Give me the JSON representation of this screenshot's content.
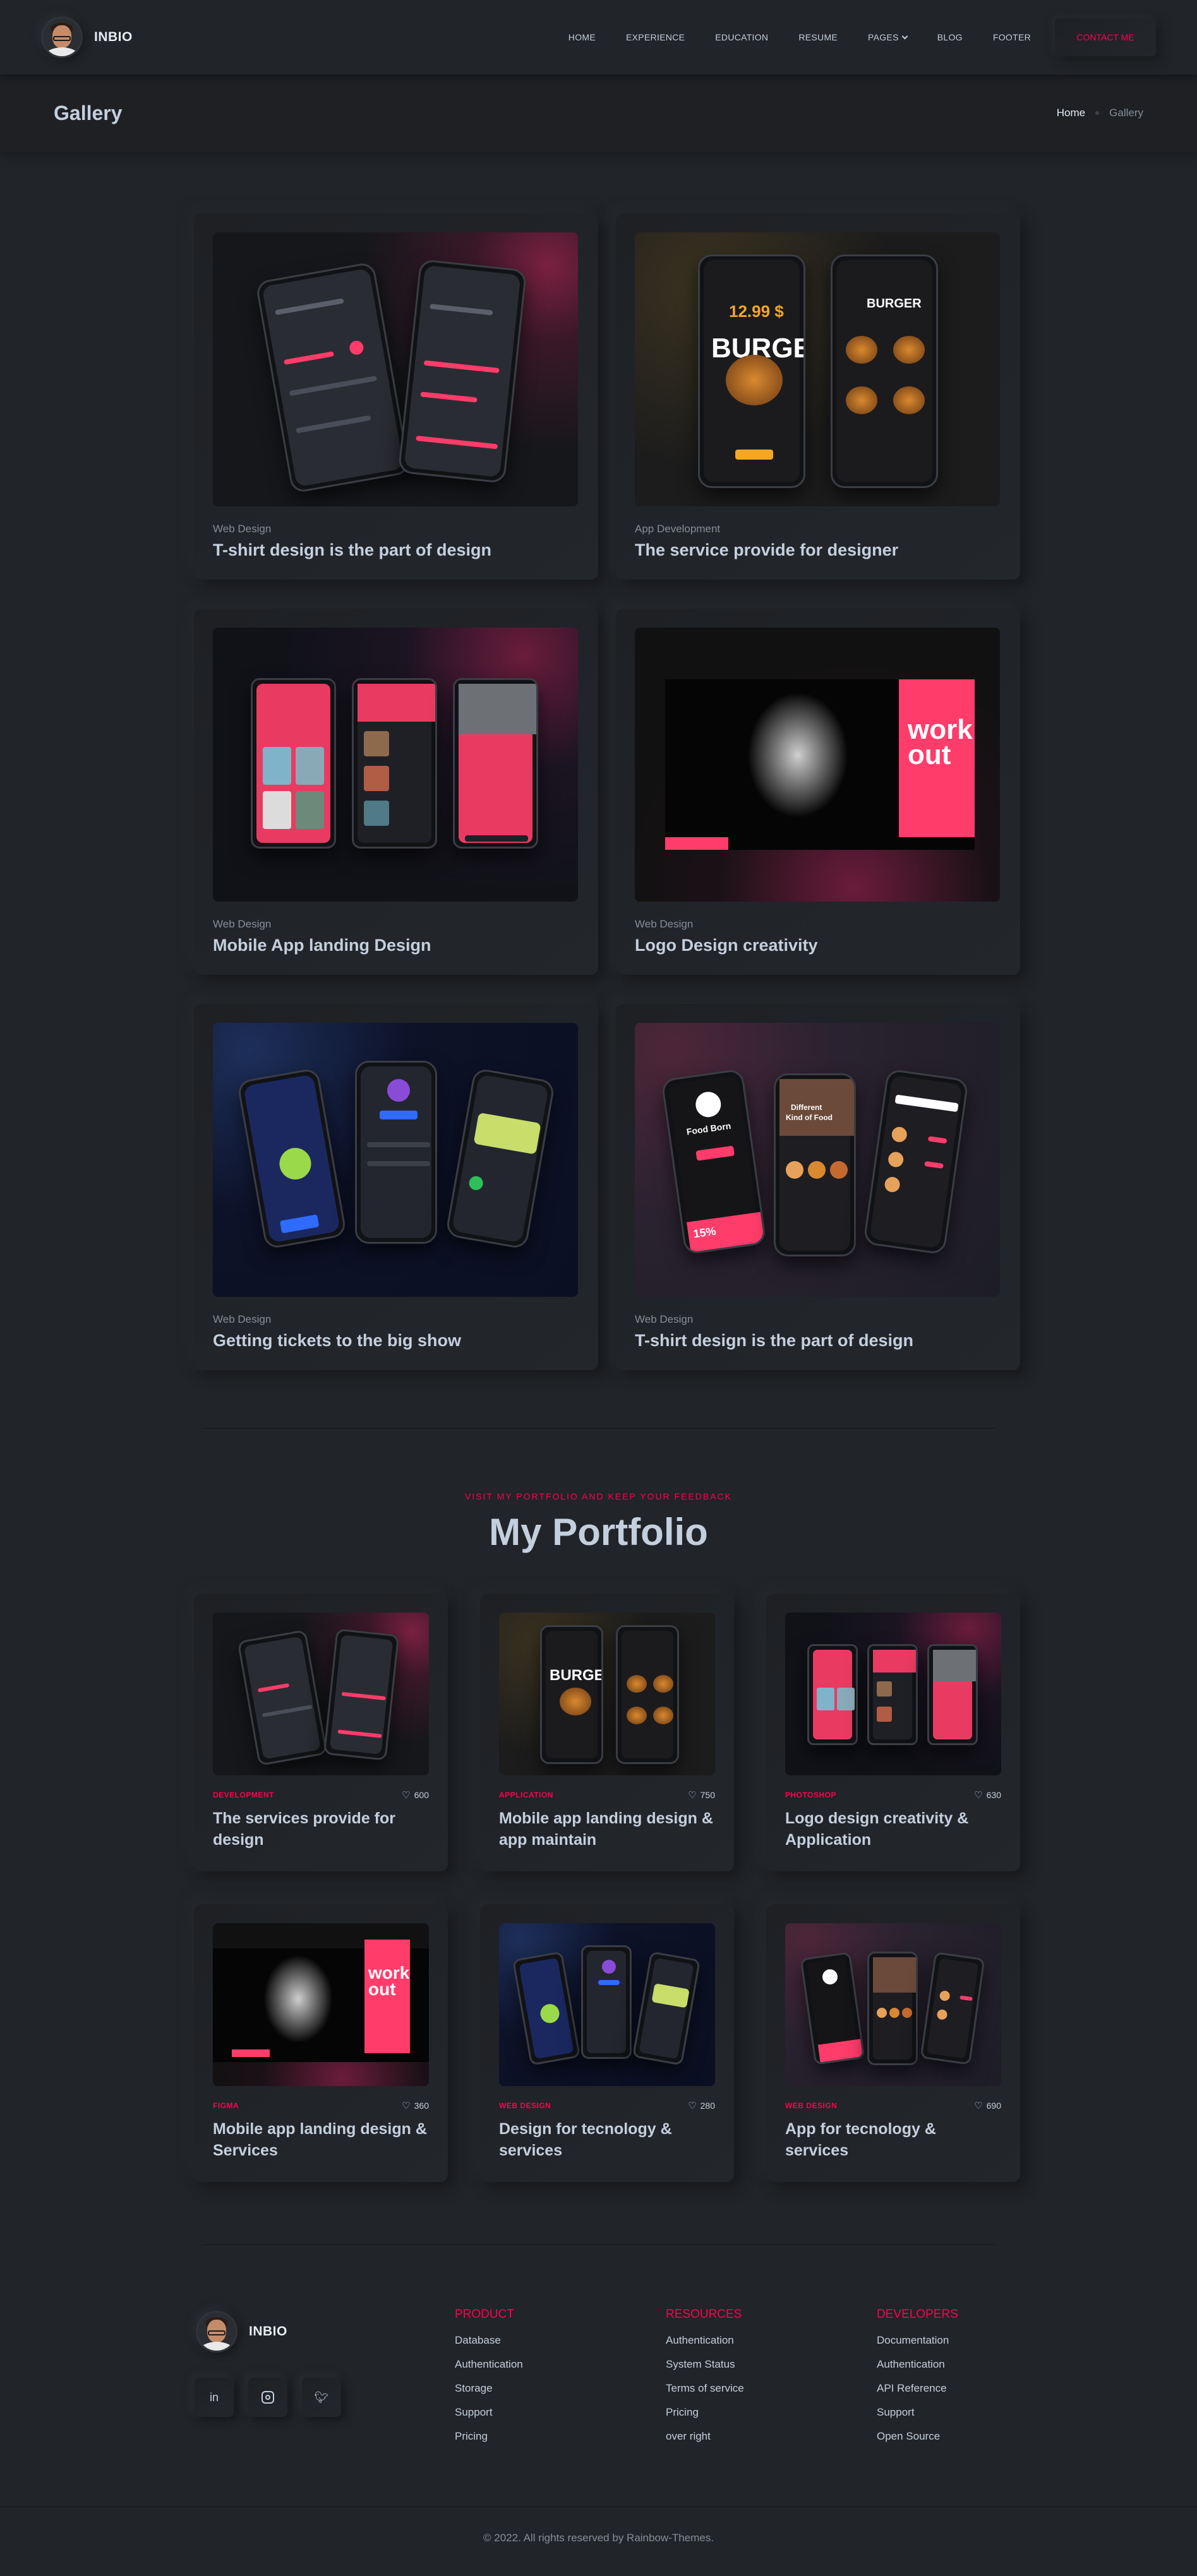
{
  "header": {
    "brand": "INBIO",
    "nav": [
      "HOME",
      "EXPERIENCE",
      "EDUCATION",
      "RESUME",
      "PAGES",
      "BLOG",
      "FOOTER"
    ],
    "contact_label": "CONTACT ME"
  },
  "breadcrumb": {
    "title": "Gallery",
    "home": "Home",
    "current": "Gallery"
  },
  "gallery": [
    {
      "category": "Web Design",
      "title": "T-shirt design is the part of design"
    },
    {
      "category": "App Development",
      "title": "The service provide for designer"
    },
    {
      "category": "Web Design",
      "title": "Mobile App landing Design"
    },
    {
      "category": "Web Design",
      "title": "Logo Design creativity"
    },
    {
      "category": "Web Design",
      "title": "Getting tickets to the big show"
    },
    {
      "category": "Web Design",
      "title": "T-shirt design is the part of design"
    }
  ],
  "thumb_text": {
    "price": "12.99 $",
    "burger": "BURGER",
    "work": "work",
    "out": "out",
    "food_born": "Food Born",
    "different": "Different",
    "kind_of_food": "Kind of Food",
    "percent": "15%"
  },
  "portfolio": {
    "subtitle": "VISIT MY PORTFOLIO AND KEEP YOUR FEEDBACK",
    "title": "My Portfolio",
    "items": [
      {
        "category": "DEVELOPMENT",
        "likes": "600",
        "title": "The services provide for design"
      },
      {
        "category": "APPLICATION",
        "likes": "750",
        "title": "Mobile app landing design & app maintain"
      },
      {
        "category": "PHOTOSHOP",
        "likes": "630",
        "title": "Logo design creativity & Application"
      },
      {
        "category": "FIGMA",
        "likes": "360",
        "title": "Mobile app landing design & Services"
      },
      {
        "category": "WEB DESIGN",
        "likes": "280",
        "title": "Design for tecnology & services"
      },
      {
        "category": "WEB DESIGN",
        "likes": "690",
        "title": "App for tecnology & services"
      }
    ]
  },
  "footer": {
    "brand": "INBIO",
    "social": [
      "linkedin-icon",
      "instagram-icon",
      "twitter-icon"
    ],
    "columns": [
      {
        "heading": "PRODUCT",
        "links": [
          "Database",
          "Authentication",
          "Storage",
          "Support",
          "Pricing"
        ]
      },
      {
        "heading": "RESOURCES",
        "links": [
          "Authentication",
          "System Status",
          "Terms of service",
          "Pricing",
          "over right"
        ]
      },
      {
        "heading": "DEVELOPERS",
        "links": [
          "Documentation",
          "Authentication",
          "API Reference",
          "Support",
          "Open Source"
        ]
      }
    ],
    "copyright": "© 2022. All rights reserved by Rainbow-Themes."
  },
  "colors": {
    "background": "#212428",
    "accent": "#ff014f",
    "text": "#c4cfde",
    "muted": "#878e99"
  }
}
